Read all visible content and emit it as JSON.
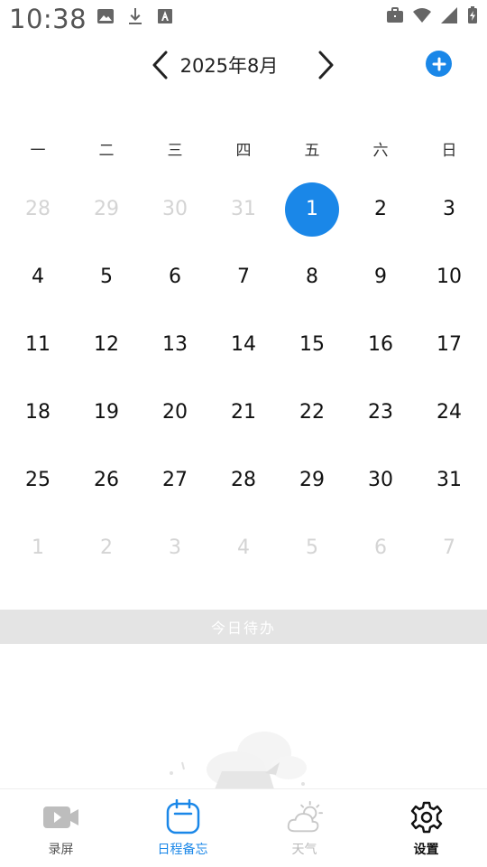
{
  "status_bar": {
    "time": "10:38",
    "left_icons": [
      "image-icon",
      "download-icon",
      "font-icon"
    ],
    "right_icons": [
      "briefcase-icon",
      "wifi-icon",
      "signal-icon",
      "battery-icon"
    ]
  },
  "header": {
    "month_label": "2025年8月",
    "add_button_color": "#1a87e8"
  },
  "calendar": {
    "weekdays": [
      "一",
      "二",
      "三",
      "四",
      "五",
      "六",
      "日"
    ],
    "days": [
      {
        "label": "28",
        "current": false
      },
      {
        "label": "29",
        "current": false
      },
      {
        "label": "30",
        "current": false
      },
      {
        "label": "31",
        "current": false
      },
      {
        "label": "1",
        "current": true,
        "selected": true
      },
      {
        "label": "2",
        "current": true
      },
      {
        "label": "3",
        "current": true
      },
      {
        "label": "4",
        "current": true
      },
      {
        "label": "5",
        "current": true
      },
      {
        "label": "6",
        "current": true
      },
      {
        "label": "7",
        "current": true
      },
      {
        "label": "8",
        "current": true
      },
      {
        "label": "9",
        "current": true
      },
      {
        "label": "10",
        "current": true
      },
      {
        "label": "11",
        "current": true
      },
      {
        "label": "12",
        "current": true
      },
      {
        "label": "13",
        "current": true
      },
      {
        "label": "14",
        "current": true
      },
      {
        "label": "15",
        "current": true
      },
      {
        "label": "16",
        "current": true
      },
      {
        "label": "17",
        "current": true
      },
      {
        "label": "18",
        "current": true
      },
      {
        "label": "19",
        "current": true
      },
      {
        "label": "20",
        "current": true
      },
      {
        "label": "21",
        "current": true
      },
      {
        "label": "22",
        "current": true
      },
      {
        "label": "23",
        "current": true
      },
      {
        "label": "24",
        "current": true
      },
      {
        "label": "25",
        "current": true
      },
      {
        "label": "26",
        "current": true
      },
      {
        "label": "27",
        "current": true
      },
      {
        "label": "28",
        "current": true
      },
      {
        "label": "29",
        "current": true
      },
      {
        "label": "30",
        "current": true
      },
      {
        "label": "31",
        "current": true
      },
      {
        "label": "1",
        "current": false
      },
      {
        "label": "2",
        "current": false
      },
      {
        "label": "3",
        "current": false
      },
      {
        "label": "4",
        "current": false
      },
      {
        "label": "5",
        "current": false
      },
      {
        "label": "6",
        "current": false
      },
      {
        "label": "7",
        "current": false
      }
    ],
    "selected_color": "#1a87e8"
  },
  "todo": {
    "title": "今日待办"
  },
  "bottom_nav": {
    "items": [
      {
        "label": "录屏",
        "icon": "video-camera-icon"
      },
      {
        "label": "日程备忘",
        "icon": "calendar-icon"
      },
      {
        "label": "天气",
        "icon": "weather-icon"
      },
      {
        "label": "设置",
        "icon": "gear-icon"
      }
    ]
  }
}
